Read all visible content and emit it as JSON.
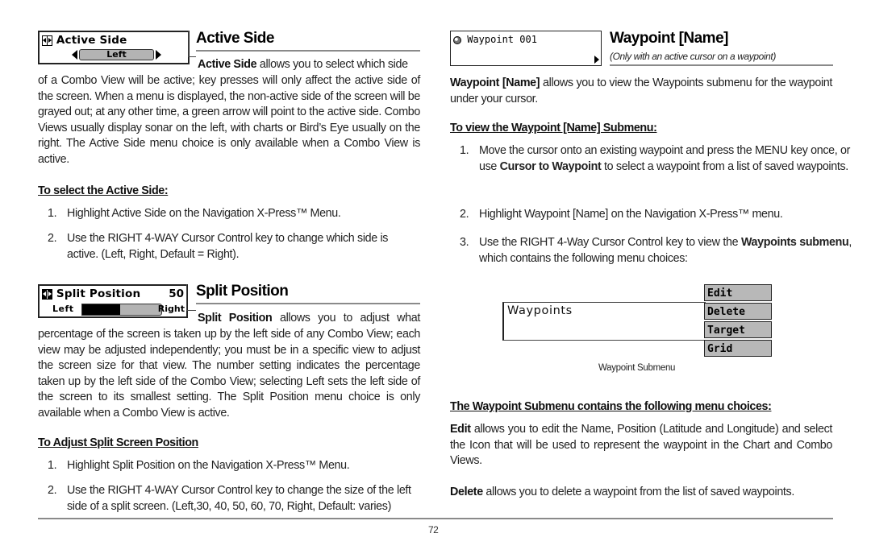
{
  "page_number": "72",
  "left_column": {
    "active_side": {
      "widget": {
        "title": "Active Side",
        "value": "Left",
        "icon": "split-view-icon"
      },
      "heading": "Active Side",
      "intro_bold": "Active Side",
      "intro_rest": " allows you to select which side",
      "paragraph": "of a Combo View will be active; key presses will only affect the active side of the screen. When a menu is displayed, the non-active side of the screen will be grayed out; at any other time, a green arrow will point to the active side. Combo Views usually display sonar on the left, with charts or Bird’s Eye usually on the right. The Active Side menu choice is only available when a Combo View is active.",
      "procedure_heading": "To select the Active Side:",
      "steps": [
        {
          "num": "1.",
          "text": "Highlight Active Side on the Navigation X-Press™ Menu."
        },
        {
          "num": "2.",
          "text": "Use the RIGHT 4-WAY Cursor Control key to change which side is active. (Left, Right, Default = Right)."
        }
      ]
    },
    "split_position": {
      "widget": {
        "title": "Split Position",
        "value": "50",
        "left_label": "Left",
        "right_label": "Right",
        "slider_fraction": 0.5,
        "icon": "split-view-icon"
      },
      "heading": "Split Position",
      "intro_bold": "Split Position",
      "intro_rest": " allows you to adjust what",
      "paragraph": "percentage of the screen is taken up by the left side of any Combo View; each view may be adjusted independently; you must be in a specific view to adjust the screen size for that view. The number setting indicates the percentage taken up by the left side of the Combo View; selecting Left sets the left side of the screen to its smallest setting. The Split Position menu choice is only available when a Combo View is active.",
      "procedure_heading": "To Adjust Split Screen Position",
      "steps": [
        {
          "num": "1.",
          "text": "Highlight Split Position on the Navigation X-Press™ Menu."
        },
        {
          "num": "2.",
          "text": "Use the RIGHT 4-WAY Cursor Control key to change the size of the left side of a split screen. (Left,30, 40, 50, 60, 70, Right, Default: varies)"
        }
      ]
    }
  },
  "right_column": {
    "waypoint_name": {
      "widget": {
        "title": "Waypoint 001",
        "icon": "waypoint-icon"
      },
      "heading": "Waypoint [Name]",
      "subheading": "(Only with an active cursor on a waypoint)",
      "intro_bold": "Waypoint [Name]",
      "intro_rest": " allows you to view the Waypoints submenu for the waypoint under your cursor.",
      "procedure_heading": "To view the Waypoint [Name] Submenu:",
      "step1_num": "1.",
      "step1_a": "Move the cursor onto an existing waypoint and press the MENU key once, or use ",
      "step1_bold": "Cursor to Waypoint",
      "step1_b": " to select a waypoint from a list of saved waypoints.",
      "step2_num": "2.",
      "step2": "Highlight Waypoint [Name] on the Navigation X-Press™ menu.",
      "step3_num": "3.",
      "step3_a": "Use the RIGHT 4-Way Cursor Control key to view the ",
      "step3_bold": "Waypoints submenu",
      "step3_b": ", which contains the following menu choices:"
    },
    "submenu_figure": {
      "title": "Waypoints",
      "items": [
        "Edit",
        "Delete",
        "Target",
        "Grid"
      ],
      "caption": "Waypoint Submenu"
    },
    "choices_heading": "The Waypoint Submenu contains the following menu choices:",
    "edit_bold": "Edit",
    "edit_rest": " allows you to edit the Name, Position (Latitude and Longitude) and select the Icon that will be used to represent the waypoint in the Chart and Combo Views.",
    "delete_bold": "Delete",
    "delete_rest": " allows you to delete a waypoint from the list of saved waypoints."
  }
}
